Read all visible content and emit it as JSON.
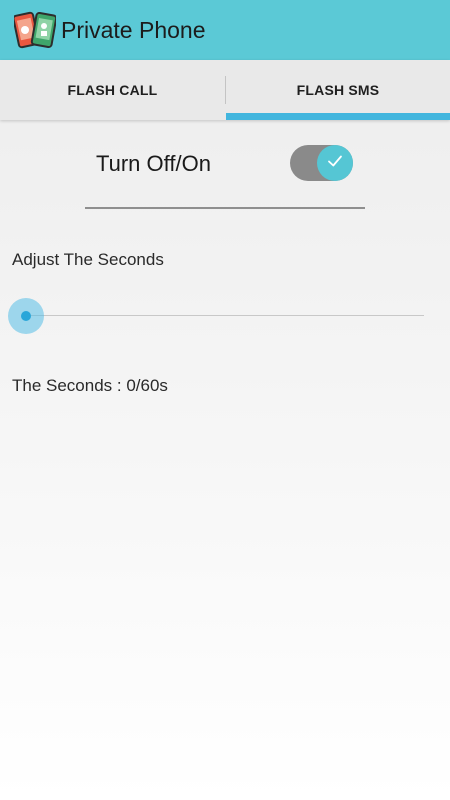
{
  "app_bar": {
    "title": "Private Phone",
    "icon": "phone-pair-icon",
    "background_color": "#5bc9d6"
  },
  "tabs": [
    {
      "label": "FLASH CALL",
      "selected": false
    },
    {
      "label": "FLASH SMS",
      "selected": true
    }
  ],
  "tab_indicator_color": "#42b6de",
  "toggle": {
    "label": "Turn Off/On",
    "checked": true,
    "icon": "check-icon",
    "accent_color": "#55c6d4"
  },
  "seconds": {
    "label": "Adjust The Seconds",
    "value": 0,
    "max": 60,
    "value_text": "The Seconds : 0/60s"
  }
}
